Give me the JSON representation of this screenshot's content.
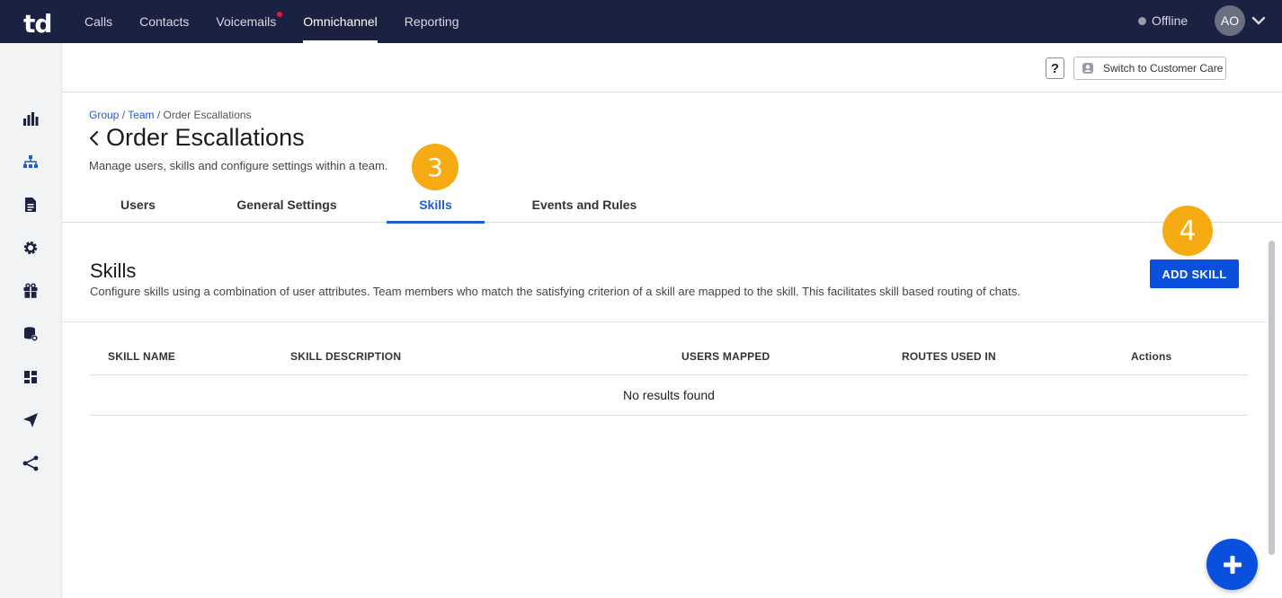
{
  "app": {
    "logo": "td"
  },
  "nav": {
    "items": [
      {
        "label": "Calls"
      },
      {
        "label": "Contacts"
      },
      {
        "label": "Voicemails",
        "notification": true
      },
      {
        "label": "Omnichannel",
        "active": true
      },
      {
        "label": "Reporting"
      }
    ],
    "status": "Offline",
    "avatar_initials": "AO"
  },
  "sidebar": {
    "icons": [
      "bar-chart-icon",
      "org-chart-icon",
      "document-icon",
      "gear-icon",
      "gift-icon",
      "database-settings-icon",
      "dashboard-icon",
      "send-icon",
      "share-icon"
    ],
    "active": "org-chart-icon"
  },
  "subheader": {
    "help_label": "?",
    "switch_label": "Switch to Customer Care"
  },
  "breadcrumb": {
    "group": "Group",
    "sep1": " / ",
    "team": "Team",
    "sep2": " / ",
    "current": "Order Escallations"
  },
  "page": {
    "title": "Order Escallations",
    "subtitle": "Manage users, skills and configure settings within a team."
  },
  "tabs": [
    {
      "label": "Users"
    },
    {
      "label": "General Settings"
    },
    {
      "label": "Skills",
      "active": true
    },
    {
      "label": "Events and Rules"
    }
  ],
  "steps": {
    "three": "3",
    "four": "4"
  },
  "skills": {
    "title": "Skills",
    "description": "Configure skills using a combination of user attributes. Team members who match the satisfying criterion of a skill are mapped to the skill. This facilitates skill based routing of chats.",
    "add_label": "ADD SKILL",
    "columns": [
      "SKILL NAME",
      "SKILL DESCRIPTION",
      "USERS MAPPED",
      "ROUTES USED IN",
      "Actions"
    ],
    "empty": "No results found"
  },
  "colors": {
    "nav_bg": "#1b2140",
    "primary": "#0b4fdf",
    "link": "#1f5ccf",
    "step_badge": "#f7ab12",
    "notification": "#f0143c"
  }
}
